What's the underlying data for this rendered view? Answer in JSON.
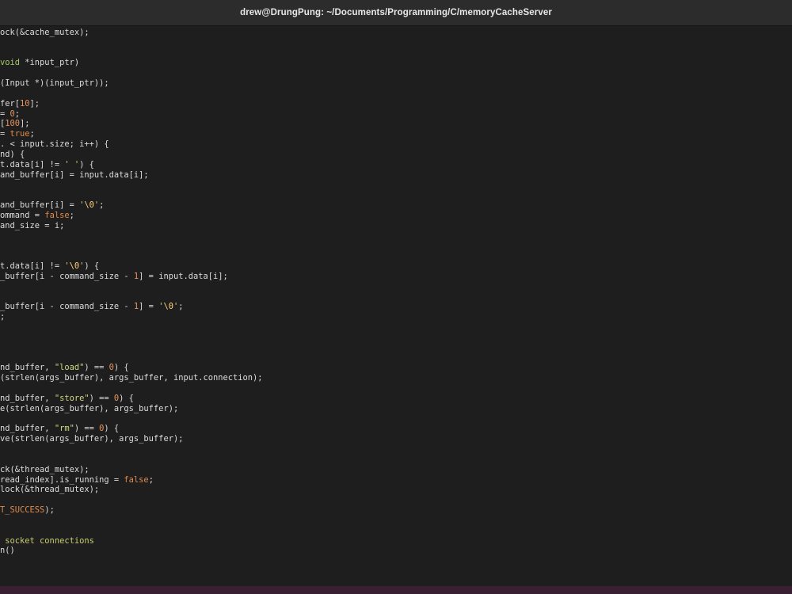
{
  "window": {
    "title": "drew@DrungPung: ~/Documents/Programming/C/memoryCacheServer"
  },
  "colors": {
    "background": "#1e1e1e",
    "plain": "#dcdcdc",
    "keyword": "#a6c968",
    "number": "#e8935f",
    "string": "#cfd77e",
    "constant": "#e08a4c",
    "comment": "#c9cd70",
    "bottom_bar": "#3a1f32"
  },
  "code": {
    "lines": [
      [
        {
          "t": "ock(&cache_mutex);",
          "k": "plain"
        }
      ],
      [],
      [],
      [
        {
          "t": "void",
          "k": "kw"
        },
        {
          "t": " *input_ptr)",
          "k": "plain"
        }
      ],
      [],
      [
        {
          "t": "(Input *)(input_ptr));",
          "k": "plain"
        }
      ],
      [],
      [
        {
          "t": "fer[",
          "k": "plain"
        },
        {
          "t": "10",
          "k": "num"
        },
        {
          "t": "];",
          "k": "plain"
        }
      ],
      [
        {
          "t": "= ",
          "k": "plain"
        },
        {
          "t": "0",
          "k": "num"
        },
        {
          "t": ";",
          "k": "plain"
        }
      ],
      [
        {
          "t": "[",
          "k": "plain"
        },
        {
          "t": "100",
          "k": "num"
        },
        {
          "t": "];",
          "k": "plain"
        }
      ],
      [
        {
          "t": "= ",
          "k": "plain"
        },
        {
          "t": "true",
          "k": "const"
        },
        {
          "t": ";",
          "k": "plain"
        }
      ],
      [
        {
          "t": ". < input.size; i++) {",
          "k": "plain"
        }
      ],
      [
        {
          "t": "nd) {",
          "k": "plain"
        }
      ],
      [
        {
          "t": "t.data[i] != ",
          "k": "plain"
        },
        {
          "t": "' '",
          "k": "str"
        },
        {
          "t": ") {",
          "k": "plain"
        }
      ],
      [
        {
          "t": "and_buffer[i] = input.data[i];",
          "k": "plain"
        }
      ],
      [],
      [],
      [
        {
          "t": "and_buffer[i] = ",
          "k": "plain"
        },
        {
          "t": "'",
          "k": "str"
        },
        {
          "t": "\\0",
          "k": "esc"
        },
        {
          "t": "'",
          "k": "str"
        },
        {
          "t": ";",
          "k": "plain"
        }
      ],
      [
        {
          "t": "ommand = ",
          "k": "plain"
        },
        {
          "t": "false",
          "k": "const"
        },
        {
          "t": ";",
          "k": "plain"
        }
      ],
      [
        {
          "t": "and_size = i;",
          "k": "plain"
        }
      ],
      [],
      [],
      [],
      [
        {
          "t": "t.data[i] != ",
          "k": "plain"
        },
        {
          "t": "'",
          "k": "str"
        },
        {
          "t": "\\0",
          "k": "esc"
        },
        {
          "t": "'",
          "k": "str"
        },
        {
          "t": ") {",
          "k": "plain"
        }
      ],
      [
        {
          "t": "_buffer[i - command_size - ",
          "k": "plain"
        },
        {
          "t": "1",
          "k": "num"
        },
        {
          "t": "] = input.data[i];",
          "k": "plain"
        }
      ],
      [],
      [],
      [
        {
          "t": "_buffer[i - command_size - ",
          "k": "plain"
        },
        {
          "t": "1",
          "k": "num"
        },
        {
          "t": "] = ",
          "k": "plain"
        },
        {
          "t": "'",
          "k": "str"
        },
        {
          "t": "\\0",
          "k": "esc"
        },
        {
          "t": "'",
          "k": "str"
        },
        {
          "t": ";",
          "k": "plain"
        }
      ],
      [
        {
          "t": ";",
          "k": "plain"
        }
      ],
      [],
      [],
      [],
      [],
      [
        {
          "t": "nd_buffer, ",
          "k": "plain"
        },
        {
          "t": "\"load\"",
          "k": "str"
        },
        {
          "t": ") == ",
          "k": "plain"
        },
        {
          "t": "0",
          "k": "num"
        },
        {
          "t": ") {",
          "k": "plain"
        }
      ],
      [
        {
          "t": "(strlen(args_buffer), args_buffer, input.connection);",
          "k": "plain"
        }
      ],
      [],
      [
        {
          "t": "nd_buffer, ",
          "k": "plain"
        },
        {
          "t": "\"store\"",
          "k": "str"
        },
        {
          "t": ") == ",
          "k": "plain"
        },
        {
          "t": "0",
          "k": "num"
        },
        {
          "t": ") {",
          "k": "plain"
        }
      ],
      [
        {
          "t": "e(strlen(args_buffer), args_buffer);",
          "k": "plain"
        }
      ],
      [],
      [
        {
          "t": "nd_buffer, ",
          "k": "plain"
        },
        {
          "t": "\"rm\"",
          "k": "str"
        },
        {
          "t": ") == ",
          "k": "plain"
        },
        {
          "t": "0",
          "k": "num"
        },
        {
          "t": ") {",
          "k": "plain"
        }
      ],
      [
        {
          "t": "ve(strlen(args_buffer), args_buffer);",
          "k": "plain"
        }
      ],
      [],
      [],
      [
        {
          "t": "ck(&thread_mutex);",
          "k": "plain"
        }
      ],
      [
        {
          "t": "read_index].is_running = ",
          "k": "plain"
        },
        {
          "t": "false",
          "k": "const"
        },
        {
          "t": ";",
          "k": "plain"
        }
      ],
      [
        {
          "t": "lock(&thread_mutex);",
          "k": "plain"
        }
      ],
      [],
      [
        {
          "t": "T_SUCCESS",
          "k": "const"
        },
        {
          "t": ");",
          "k": "plain"
        }
      ],
      [],
      [],
      [
        {
          "t": " socket connections",
          "k": "cmt"
        }
      ],
      [
        {
          "t": "n()",
          "k": "plain"
        }
      ]
    ]
  }
}
